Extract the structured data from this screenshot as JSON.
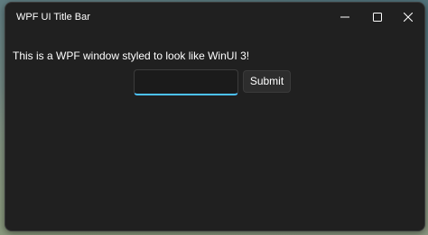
{
  "window": {
    "title": "WPF UI Title Bar",
    "body_text": "This is a WPF window styled to look like WinUI 3!"
  },
  "form": {
    "input_value": "",
    "submit_label": "Submit"
  },
  "icons": {
    "minimize": "minimize-icon",
    "maximize": "maximize-icon",
    "close": "close-icon"
  },
  "colors": {
    "window_bg": "#202020",
    "accent": "#4cc2ff",
    "text": "#ffffff"
  }
}
